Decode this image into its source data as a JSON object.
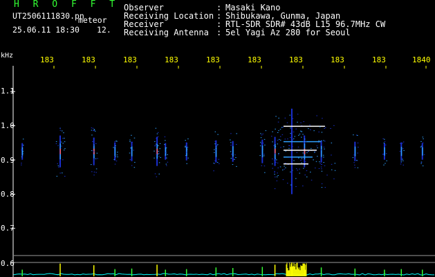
{
  "header": {
    "program": "H R O F F T",
    "filename": "UT2506111830.pn",
    "filename_suffix": "meteor",
    "timestamp": "25.06.11 18:30",
    "timestamp_suffix": "12."
  },
  "info": [
    {
      "label": "Observer",
      "sep": ":",
      "value": "Masaki Kano"
    },
    {
      "label": "Receiving Location",
      "sep": ":",
      "value": "Shibukawa, Gunma, Japan"
    },
    {
      "label": "Receiver",
      "sep": ":",
      "value": "RTL-SDR SDR# 43dB L15 96.7MHz CW"
    },
    {
      "label": "Receiving Antenna",
      "sep": ":",
      "value": "5el Yagi Az 280 for Seoul"
    }
  ],
  "axis": {
    "y_unit": "kHz",
    "x_ticks": [
      "183",
      "183",
      "183",
      "183",
      "183",
      "183",
      "183",
      "183",
      "183",
      "1840"
    ],
    "y_ticks": [
      "1.1",
      "1.0",
      "0.9",
      "0.8",
      "0.7",
      "0.6"
    ]
  },
  "colors": {
    "text": "#ffffff",
    "x_tick": "#ffff00",
    "title": "#33ff33",
    "signal_dark": "#1a2fd0",
    "signal_mid": "#2fa0ff",
    "signal_hot": "#ffffff",
    "trace_green": "#33ff33",
    "trace_cyan": "#00ffff",
    "trace_yellow": "#ffff00"
  },
  "spectrogram": {
    "baseline_khz": 0.925,
    "events": [
      {
        "t": 0.02,
        "strength": 0.35,
        "spread": 0.03
      },
      {
        "t": 0.11,
        "strength": 0.9,
        "spread": 0.08
      },
      {
        "t": 0.19,
        "strength": 0.75,
        "spread": 0.06
      },
      {
        "t": 0.24,
        "strength": 0.4,
        "spread": 0.04
      },
      {
        "t": 0.28,
        "strength": 0.45,
        "spread": 0.05
      },
      {
        "t": 0.34,
        "strength": 0.8,
        "spread": 0.06
      },
      {
        "t": 0.36,
        "strength": 0.35,
        "spread": 0.03
      },
      {
        "t": 0.41,
        "strength": 0.4,
        "spread": 0.04
      },
      {
        "t": 0.48,
        "strength": 0.55,
        "spread": 0.05
      },
      {
        "t": 0.52,
        "strength": 0.5,
        "spread": 0.06
      },
      {
        "t": 0.59,
        "strength": 0.6,
        "spread": 0.06
      },
      {
        "t": 0.62,
        "strength": 0.8,
        "spread": 0.07
      },
      {
        "t": 0.66,
        "strength": 1.0,
        "spread": 0.18
      },
      {
        "t": 0.69,
        "strength": 0.9,
        "spread": 0.12
      },
      {
        "t": 0.73,
        "strength": 0.55,
        "spread": 0.06
      },
      {
        "t": 0.81,
        "strength": 0.45,
        "spread": 0.05
      },
      {
        "t": 0.88,
        "strength": 0.35,
        "spread": 0.04
      },
      {
        "t": 0.92,
        "strength": 0.4,
        "spread": 0.04
      },
      {
        "t": 0.97,
        "strength": 0.35,
        "spread": 0.04
      }
    ]
  }
}
